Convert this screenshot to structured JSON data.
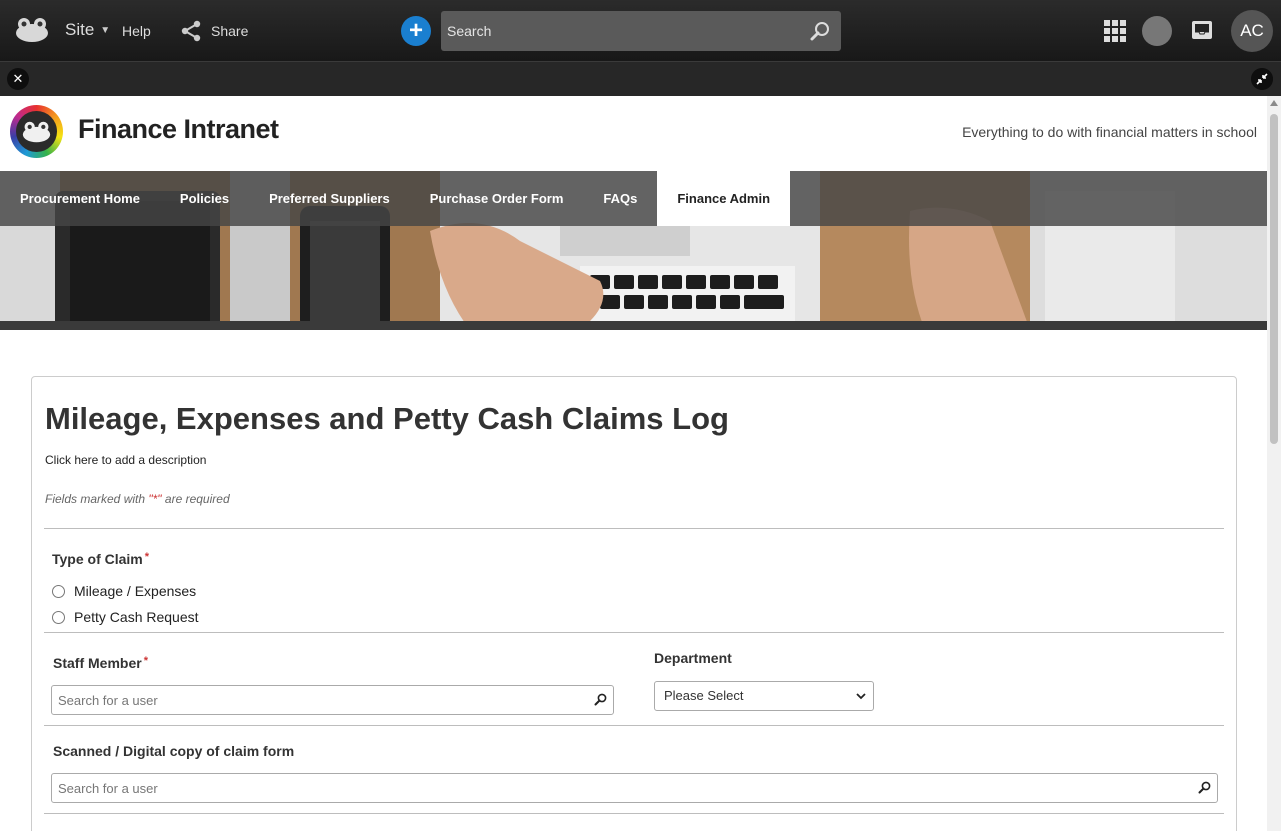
{
  "topbar": {
    "site_label": "Site",
    "help_label": "Help",
    "share_label": "Share",
    "search_placeholder": "Search",
    "avatar_initials": "AC"
  },
  "site": {
    "title": "Finance Intranet",
    "tagline": "Everything to do with financial matters in school"
  },
  "nav": {
    "items": [
      {
        "label": "Procurement Home",
        "active": false
      },
      {
        "label": "Policies",
        "active": false
      },
      {
        "label": "Preferred Suppliers",
        "active": false
      },
      {
        "label": "Purchase Order Form",
        "active": false
      },
      {
        "label": "FAQs",
        "active": false
      },
      {
        "label": "Finance Admin",
        "active": true
      }
    ]
  },
  "form": {
    "title": "Mileage, Expenses and Petty Cash Claims Log",
    "description": "Click here to add a description",
    "required_note_prefix": "Fields marked with ",
    "required_note_symbol": "\"*\"",
    "required_note_suffix": " are required",
    "required_marker": "*",
    "type_of_claim": {
      "label": "Type of Claim",
      "options": [
        "Mileage / Expenses",
        "Petty Cash Request"
      ]
    },
    "staff_member": {
      "label": "Staff Member",
      "placeholder": "Search for a user"
    },
    "department": {
      "label": "Department",
      "selected": "Please Select"
    },
    "scanned_copy": {
      "label": "Scanned / Digital copy of claim form",
      "placeholder": "Search for a user"
    }
  },
  "colors": {
    "topbar_bg": "#1f1f1f",
    "add_button": "#1a7fd0",
    "required_asterisk": "#cc3333"
  }
}
